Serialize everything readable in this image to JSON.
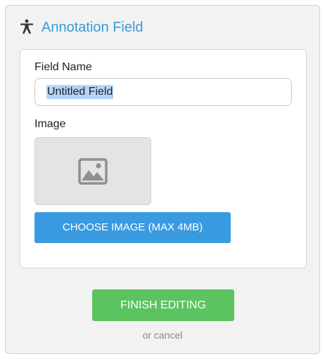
{
  "header": {
    "title": "Annotation Field",
    "icon": "accessibility-person-icon",
    "title_color": "#3a9ad9"
  },
  "form": {
    "field_name_label": "Field Name",
    "field_name_value": "Untitled Field",
    "image_label": "Image",
    "image_placeholder_icon": "image-icon",
    "choose_image_label": "CHOOSE IMAGE (MAX 4MB)"
  },
  "actions": {
    "finish_label": "FINISH EDITING",
    "cancel_label": "or cancel"
  },
  "colors": {
    "primary_blue": "#3a9ae0",
    "finish_green": "#5bc35f",
    "selection_highlight": "#b4d5fb"
  }
}
